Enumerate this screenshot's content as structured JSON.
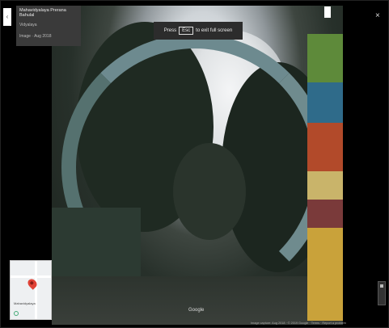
{
  "info_card": {
    "title": "Mahavidyalaya Prerana Bahulal",
    "subtitle": "Vidyalaya",
    "date": "Image · Aug 2018"
  },
  "fullscreen_prompt": {
    "press": "Press",
    "key": "Esc",
    "suffix": "to exit full screen"
  },
  "close_label": "×",
  "back_label": "‹",
  "credit": "Google",
  "minimap": {
    "label": "Mahavidyalaya"
  },
  "footer": "Image capture: Aug 2018 · © 2019 Google · Terms · Report a problem",
  "colors": {
    "background": "#000000",
    "card": "#3a3a3a",
    "pin": "#e04236"
  }
}
